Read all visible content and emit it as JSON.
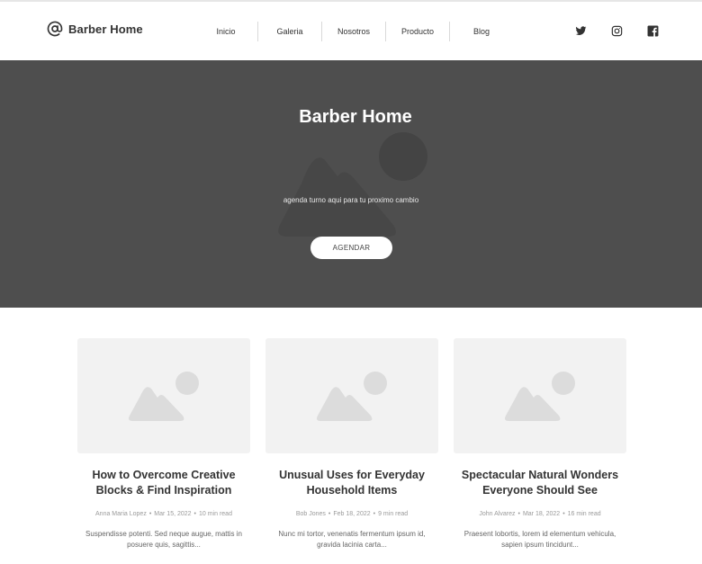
{
  "brand": {
    "name": "Barber Home",
    "icon": "at-sign-icon"
  },
  "nav": {
    "items": [
      {
        "label": "Inicio"
      },
      {
        "label": "Galeria"
      },
      {
        "label": "Nosotros"
      },
      {
        "label": "Producto"
      },
      {
        "label": "Blog"
      }
    ]
  },
  "social": [
    {
      "name": "twitter-icon"
    },
    {
      "name": "instagram-icon"
    },
    {
      "name": "facebook-icon"
    }
  ],
  "hero": {
    "title": "Barber Home",
    "subtitle": "agenda turno aqui para tu proximo cambio",
    "button_label": "AGENDAR",
    "background": "#4e4e4e"
  },
  "posts": [
    {
      "title": "How to Overcome Creative Blocks & Find Inspiration",
      "author": "Anna Maria Lopez",
      "date": "Mar 15, 2022",
      "read_time": "10 min read",
      "excerpt": "Suspendisse potenti. Sed neque augue, mattis in posuere quis, sagittis..."
    },
    {
      "title": "Unusual Uses for Everyday Household Items",
      "author": "Bob Jones",
      "date": "Feb 18, 2022",
      "read_time": "9 min read",
      "excerpt": "Nunc mi tortor, venenatis fermentum ipsum id, gravida lacinia carta..."
    },
    {
      "title": "Spectacular Natural Wonders Everyone Should See",
      "author": "John Alvarez",
      "date": "Mar 18, 2022",
      "read_time": "16 min read",
      "excerpt": "Praesent lobortis, lorem id elementum vehicula, sapien ipsum tincidunt..."
    }
  ]
}
